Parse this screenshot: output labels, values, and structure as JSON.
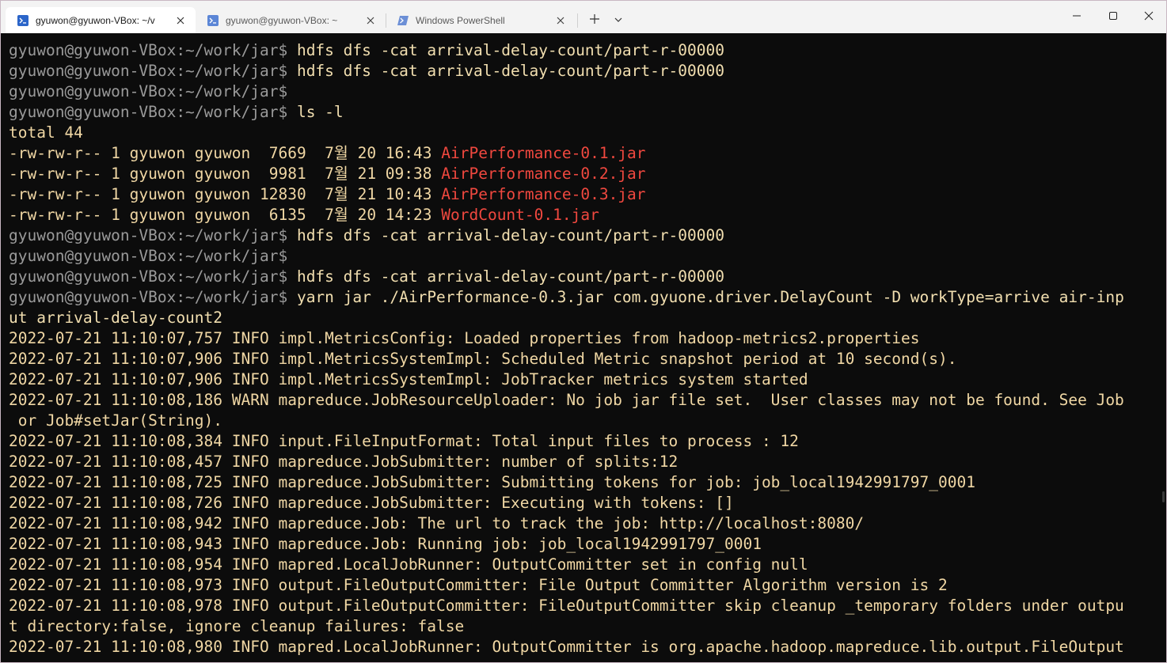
{
  "tabs": [
    {
      "title": "gyuwon@gyuwon-VBox: ~/v",
      "active": true,
      "icon": "linux-terminal-icon"
    },
    {
      "title": "gyuwon@gyuwon-VBox: ~",
      "active": false,
      "icon": "linux-terminal-icon"
    },
    {
      "title": "Windows PowerShell",
      "active": false,
      "icon": "powershell-icon"
    }
  ],
  "toolbar": {
    "new_tab_icon": "plus-icon",
    "dropdown_icon": "chevron-down-icon"
  },
  "window_controls": {
    "minimize_icon": "minimize-icon",
    "maximize_icon": "maximize-icon",
    "close_icon": "close-icon"
  },
  "colors": {
    "prompt": "#9a9a9a",
    "command": "#f2dfb0",
    "output": "#f0d7a4",
    "jar_file": "#f0483f",
    "background": "#0c0c0c"
  },
  "terminal": {
    "lines": [
      [
        {
          "t": "gyuwon@gyuwon-VBox:~/work/jar$ ",
          "c": "prompt"
        },
        {
          "t": "hdfs dfs -cat arrival-delay-count/part-r-00000",
          "c": "cmd"
        }
      ],
      [
        {
          "t": "gyuwon@gyuwon-VBox:~/work/jar$ ",
          "c": "prompt"
        },
        {
          "t": "hdfs dfs -cat arrival-delay-count/part-r-00000",
          "c": "cmd"
        }
      ],
      [
        {
          "t": "gyuwon@gyuwon-VBox:~/work/jar$",
          "c": "prompt"
        }
      ],
      [
        {
          "t": "gyuwon@gyuwon-VBox:~/work/jar$ ",
          "c": "prompt"
        },
        {
          "t": "ls -l",
          "c": "cmd"
        }
      ],
      [
        {
          "t": "total 44",
          "c": "plain"
        }
      ],
      [
        {
          "t": "-rw-rw-r-- 1 gyuwon gyuwon  7669  7월 20 16:43 ",
          "c": "plain"
        },
        {
          "t": "AirPerformance-0.1.jar",
          "c": "red"
        }
      ],
      [
        {
          "t": "-rw-rw-r-- 1 gyuwon gyuwon  9981  7월 21 09:38 ",
          "c": "plain"
        },
        {
          "t": "AirPerformance-0.2.jar",
          "c": "red"
        }
      ],
      [
        {
          "t": "-rw-rw-r-- 1 gyuwon gyuwon 12830  7월 21 10:43 ",
          "c": "plain"
        },
        {
          "t": "AirPerformance-0.3.jar",
          "c": "red"
        }
      ],
      [
        {
          "t": "-rw-rw-r-- 1 gyuwon gyuwon  6135  7월 20 14:23 ",
          "c": "plain"
        },
        {
          "t": "WordCount-0.1.jar",
          "c": "red"
        }
      ],
      [
        {
          "t": "gyuwon@gyuwon-VBox:~/work/jar$ ",
          "c": "prompt"
        },
        {
          "t": "hdfs dfs -cat arrival-delay-count/part-r-00000",
          "c": "cmd"
        }
      ],
      [
        {
          "t": "gyuwon@gyuwon-VBox:~/work/jar$",
          "c": "prompt"
        }
      ],
      [
        {
          "t": "gyuwon@gyuwon-VBox:~/work/jar$ ",
          "c": "prompt"
        },
        {
          "t": "hdfs dfs -cat arrival-delay-count/part-r-00000",
          "c": "cmd"
        }
      ],
      [
        {
          "t": "gyuwon@gyuwon-VBox:~/work/jar$ ",
          "c": "prompt"
        },
        {
          "t": "yarn jar ./AirPerformance-0.3.jar com.gyuone.driver.DelayCount -D workType=arrive air-inp",
          "c": "cmd"
        }
      ],
      [
        {
          "t": "ut arrival-delay-count2",
          "c": "cmd"
        }
      ],
      [
        {
          "t": "2022-07-21 11:10:07,757 INFO impl.MetricsConfig: Loaded properties from hadoop-metrics2.properties",
          "c": "plain"
        }
      ],
      [
        {
          "t": "2022-07-21 11:10:07,906 INFO impl.MetricsSystemImpl: Scheduled Metric snapshot period at 10 second(s).",
          "c": "plain"
        }
      ],
      [
        {
          "t": "2022-07-21 11:10:07,906 INFO impl.MetricsSystemImpl: JobTracker metrics system started",
          "c": "plain"
        }
      ],
      [
        {
          "t": "2022-07-21 11:10:08,186 WARN mapreduce.JobResourceUploader: No job jar file set.  User classes may not be found. See Job",
          "c": "plain"
        }
      ],
      [
        {
          "t": " or Job#setJar(String).",
          "c": "plain"
        }
      ],
      [
        {
          "t": "2022-07-21 11:10:08,384 INFO input.FileInputFormat: Total input files to process : 12",
          "c": "plain"
        }
      ],
      [
        {
          "t": "2022-07-21 11:10:08,457 INFO mapreduce.JobSubmitter: number of splits:12",
          "c": "plain"
        }
      ],
      [
        {
          "t": "2022-07-21 11:10:08,725 INFO mapreduce.JobSubmitter: Submitting tokens for job: job_local1942991797_0001",
          "c": "plain"
        }
      ],
      [
        {
          "t": "2022-07-21 11:10:08,726 INFO mapreduce.JobSubmitter: Executing with tokens: []",
          "c": "plain"
        }
      ],
      [
        {
          "t": "2022-07-21 11:10:08,942 INFO mapreduce.Job: The url to track the job: http://localhost:8080/",
          "c": "plain"
        }
      ],
      [
        {
          "t": "2022-07-21 11:10:08,943 INFO mapreduce.Job: Running job: job_local1942991797_0001",
          "c": "plain"
        }
      ],
      [
        {
          "t": "2022-07-21 11:10:08,954 INFO mapred.LocalJobRunner: OutputCommitter set in config null",
          "c": "plain"
        }
      ],
      [
        {
          "t": "2022-07-21 11:10:08,973 INFO output.FileOutputCommitter: File Output Committer Algorithm version is 2",
          "c": "plain"
        }
      ],
      [
        {
          "t": "2022-07-21 11:10:08,978 INFO output.FileOutputCommitter: FileOutputCommitter skip cleanup _temporary folders under outpu",
          "c": "plain"
        }
      ],
      [
        {
          "t": "t directory:false, ignore cleanup failures: false",
          "c": "plain"
        }
      ],
      [
        {
          "t": "2022-07-21 11:10:08,980 INFO mapred.LocalJobRunner: OutputCommitter is org.apache.hadoop.mapreduce.lib.output.FileOutput",
          "c": "plain"
        }
      ]
    ]
  }
}
